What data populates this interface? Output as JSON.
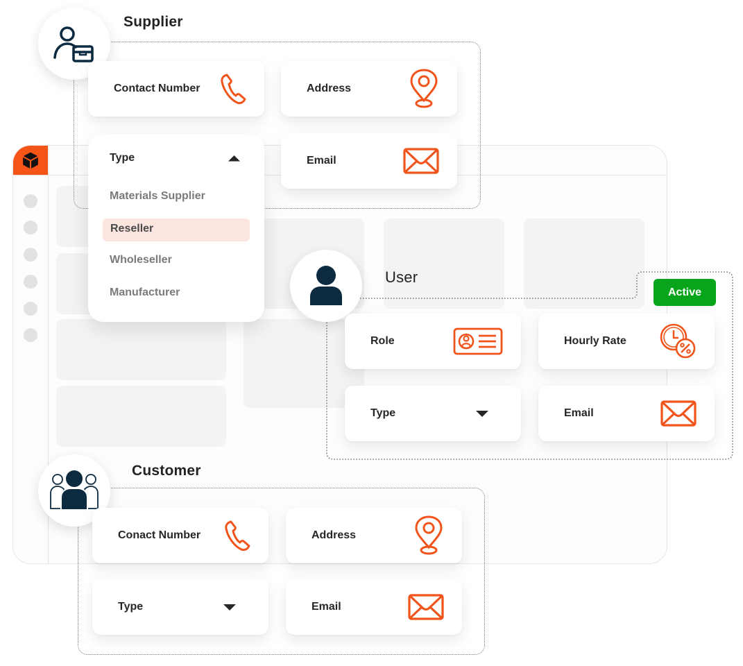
{
  "app": {
    "logo_icon": "cube-icon",
    "accent_color": "#f75418",
    "nav_item_count": 6
  },
  "supplier": {
    "title": "Supplier",
    "avatar_icon": "user-box-icon",
    "fields": {
      "contact_number": {
        "label": "Contact Number",
        "icon": "phone-icon"
      },
      "address": {
        "label": "Address",
        "icon": "map-pin-icon"
      },
      "email": {
        "label": "Email",
        "icon": "envelope-icon"
      }
    },
    "type_dropdown": {
      "label": "Type",
      "state": "expanded",
      "icon": "caret-up-icon",
      "options": [
        "Materials Supplier",
        "Reseller",
        "Wholeseller",
        "Manufacturer"
      ],
      "selected": "Reseller"
    }
  },
  "user": {
    "title": "User",
    "avatar_icon": "user-icon",
    "status_badge": {
      "label": "Active",
      "color": "#08a51c"
    },
    "fields": {
      "role": {
        "label": "Role",
        "icon": "id-card-icon"
      },
      "hourly_rate": {
        "label": "Hourly Rate",
        "icon": "clock-percent-icon"
      },
      "type": {
        "label": "Type",
        "icon": "caret-down-icon"
      },
      "email": {
        "label": "Email",
        "icon": "envelope-icon"
      }
    }
  },
  "customer": {
    "title": "Customer",
    "avatar_icon": "users-group-icon",
    "fields": {
      "contact_number": {
        "label": "Conact Number",
        "icon": "phone-icon"
      },
      "address": {
        "label": "Address",
        "icon": "map-pin-icon"
      },
      "type": {
        "label": "Type",
        "icon": "caret-down-icon"
      },
      "email": {
        "label": "Email",
        "icon": "envelope-icon"
      }
    }
  }
}
